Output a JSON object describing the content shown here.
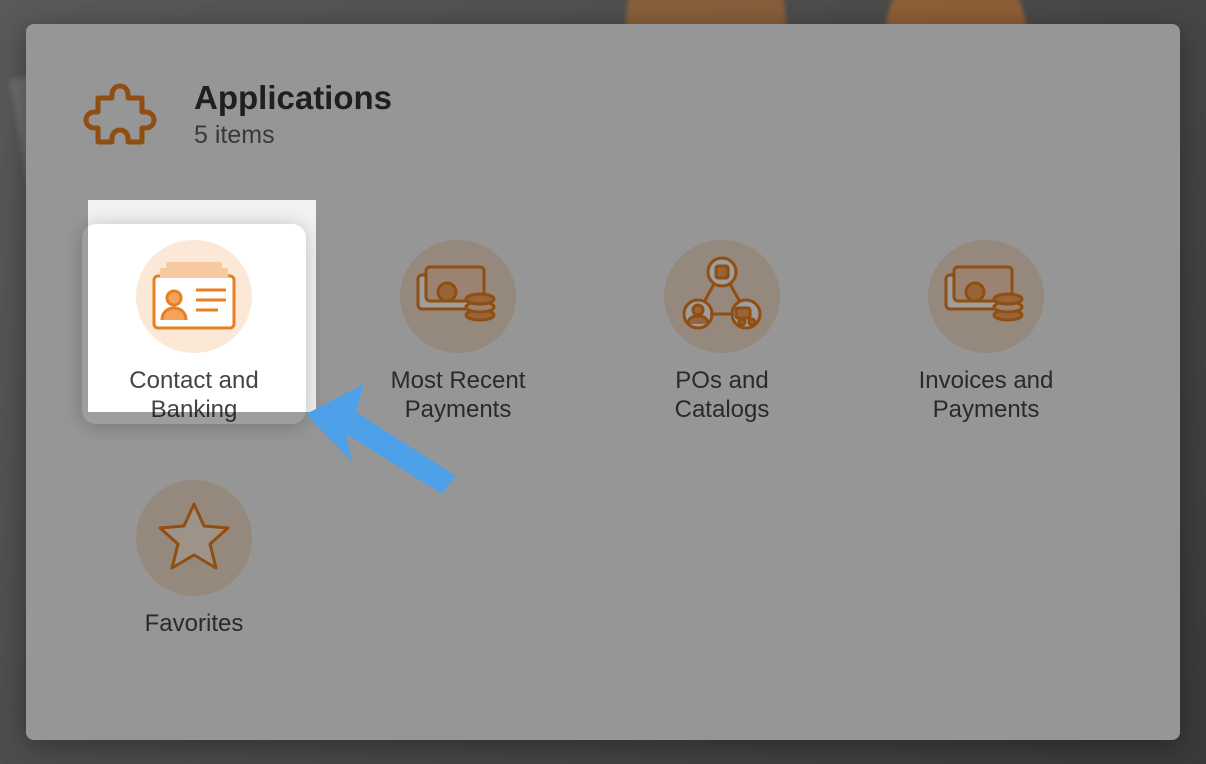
{
  "header": {
    "title": "Applications",
    "subtitle": "5 items"
  },
  "tiles": [
    {
      "id": "contact-banking",
      "label": "Contact and\nBanking",
      "icon": "id-card-icon",
      "highlight": true
    },
    {
      "id": "most-recent-payments",
      "label": "Most Recent\nPayments",
      "icon": "money-icon",
      "highlight": false
    },
    {
      "id": "pos-catalogs",
      "label": "POs and\nCatalogs",
      "icon": "network-icon",
      "highlight": false
    },
    {
      "id": "invoices-payments",
      "label": "Invoices and\nPayments",
      "icon": "money-icon",
      "highlight": false
    },
    {
      "id": "favorites",
      "label": "Favorites",
      "icon": "star-icon",
      "highlight": false
    }
  ],
  "colors": {
    "accent": "#e87f20",
    "arrow": "#4ea1e8"
  }
}
